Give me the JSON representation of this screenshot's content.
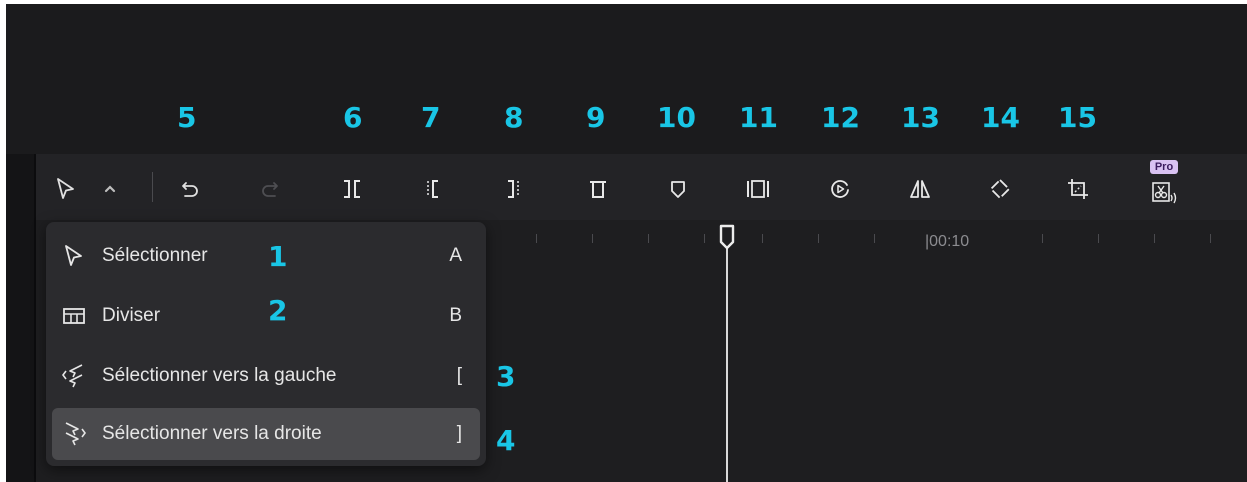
{
  "callouts": {
    "c5": "5",
    "c6": "6",
    "c7": "7",
    "c8": "8",
    "c9": "9",
    "c10": "10",
    "c11": "11",
    "c12": "12",
    "c13": "13",
    "c14": "14",
    "c15": "15"
  },
  "toolbar": {
    "icons": [
      "cursor-icon",
      "chevron-up-icon",
      "undo-icon",
      "redo-icon",
      "split-icon",
      "split-left-icon",
      "split-right-icon",
      "delete-icon",
      "marker-icon",
      "freeze-frame-icon",
      "speed-icon",
      "mirror-icon",
      "rotate-icon",
      "crop-icon",
      "voice-scissors-icon"
    ],
    "pro_label": "Pro"
  },
  "timeline": {
    "time_label": "|00:10"
  },
  "menu": {
    "items": [
      {
        "label": "Sélectionner",
        "key": "A",
        "callout": "1",
        "icon": "cursor-icon"
      },
      {
        "label": "Diviser",
        "key": "B",
        "callout": "2",
        "icon": "split-box-icon"
      },
      {
        "label": "Sélectionner vers la gauche",
        "key": "[",
        "callout": "3",
        "icon": "select-left-icon"
      },
      {
        "label": "Sélectionner vers la droite",
        "key": "]",
        "callout": "4",
        "icon": "select-right-icon"
      }
    ],
    "active_index": 3
  },
  "colors": {
    "callout": "#19c6e6",
    "background": "#1b1b1d",
    "menu_bg": "#2b2b2e",
    "menu_active": "#4a4a4d"
  }
}
